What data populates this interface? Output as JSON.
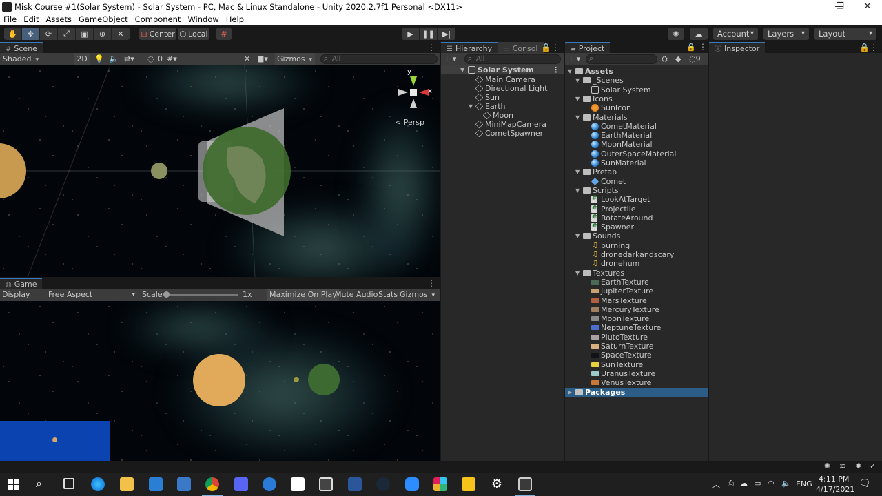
{
  "window": {
    "title": "Misk Course #1(Solar System) - Solar System - PC, Mac & Linux Standalone - Unity 2020.2.7f1 Personal <DX11>",
    "controls": [
      "—",
      "❐",
      "✕"
    ]
  },
  "menu": [
    "File",
    "Edit",
    "Assets",
    "GameObject",
    "Component",
    "Window",
    "Help"
  ],
  "toolbar": {
    "pivot": "Center",
    "space": "Local",
    "account": "Account",
    "layers": "Layers",
    "layout": "Layout"
  },
  "scene": {
    "tab": "Scene",
    "draw_mode": "Shaded",
    "mode_2d": "2D",
    "hidden_count": "0",
    "gizmos": "Gizmos",
    "search_placeholder": "All",
    "persp": "< Persp",
    "axis_y": "y",
    "axis_x": "x"
  },
  "game": {
    "tab": "Game",
    "display": "Display 1",
    "aspect": "Free Aspect",
    "scale_label": "Scale",
    "scale_value": "1x",
    "maximize": "Maximize On Play",
    "mute": "Mute Audio",
    "stats": "Stats",
    "gizmos": "Gizmos"
  },
  "hierarchy": {
    "tab": "Hierarchy",
    "tab2": "Consol",
    "search_placeholder": "All",
    "root": "Solar System",
    "items": [
      {
        "label": "Main Camera",
        "depth": 1
      },
      {
        "label": "Directional Light",
        "depth": 1
      },
      {
        "label": "Sun",
        "depth": 1
      },
      {
        "label": "Earth",
        "depth": 1
      },
      {
        "label": "Moon",
        "depth": 2
      },
      {
        "label": "MiniMapCamera",
        "depth": 1
      },
      {
        "label": "CometSpawner",
        "depth": 1
      }
    ]
  },
  "project": {
    "tab": "Project",
    "hidden_count": "9",
    "assets_label": "Assets",
    "packages_label": "Packages",
    "folders": [
      {
        "name": "_Scenes",
        "items": [
          {
            "label": "Solar System",
            "icon": "scene-icon"
          }
        ]
      },
      {
        "name": "Icons",
        "items": [
          {
            "label": "SunIcon",
            "icon": "sun-icon"
          }
        ]
      },
      {
        "name": "Materials",
        "items": [
          {
            "label": "CometMaterial",
            "icon": "material-icon"
          },
          {
            "label": "EarthMaterial",
            "icon": "material-icon"
          },
          {
            "label": "MoonMaterial",
            "icon": "material-icon"
          },
          {
            "label": "OuterSpaceMaterial",
            "icon": "material-icon"
          },
          {
            "label": "SunMaterial",
            "icon": "material-icon"
          }
        ]
      },
      {
        "name": "Prefab",
        "items": [
          {
            "label": "Comet",
            "icon": "prefab-icon"
          }
        ]
      },
      {
        "name": "Scripts",
        "items": [
          {
            "label": "LookAtTarget",
            "icon": "script-icon"
          },
          {
            "label": "Projectile",
            "icon": "script-icon"
          },
          {
            "label": "RotateAround",
            "icon": "script-icon"
          },
          {
            "label": "Spawner",
            "icon": "script-icon"
          }
        ]
      },
      {
        "name": "Sounds",
        "items": [
          {
            "label": "burning",
            "icon": "audio-icon"
          },
          {
            "label": "dronedarkandscary",
            "icon": "audio-icon"
          },
          {
            "label": "dronehum",
            "icon": "audio-icon"
          }
        ]
      },
      {
        "name": "Textures",
        "items": [
          {
            "label": "EarthTexture",
            "icon": "texture-icon",
            "color": "#4b6a55"
          },
          {
            "label": "JupiterTexture",
            "icon": "texture-icon",
            "color": "#c9a070"
          },
          {
            "label": "MarsTexture",
            "icon": "texture-icon",
            "color": "#b0603c"
          },
          {
            "label": "MercuryTexture",
            "icon": "texture-icon",
            "color": "#a08060"
          },
          {
            "label": "MoonTexture",
            "icon": "texture-icon",
            "color": "#8a8a8a"
          },
          {
            "label": "NeptuneTexture",
            "icon": "texture-icon",
            "color": "#4a6fd0"
          },
          {
            "label": "PlutoTexture",
            "icon": "texture-icon",
            "color": "#a8a0a0"
          },
          {
            "label": "SaturnTexture",
            "icon": "texture-icon",
            "color": "#d8b080"
          },
          {
            "label": "SpaceTexture",
            "icon": "texture-icon",
            "color": "#101418"
          },
          {
            "label": "SunTexture",
            "icon": "texture-icon",
            "color": "#e8d040"
          },
          {
            "label": "UranusTexture",
            "icon": "texture-icon",
            "color": "#9cc8c8"
          },
          {
            "label": "VenusTexture",
            "icon": "texture-icon",
            "color": "#c87838"
          }
        ]
      }
    ]
  },
  "inspector": {
    "tab": "Inspector"
  },
  "taskbar": {
    "language": "ENG",
    "time": "4:11 PM",
    "date": "4/17/2021"
  }
}
